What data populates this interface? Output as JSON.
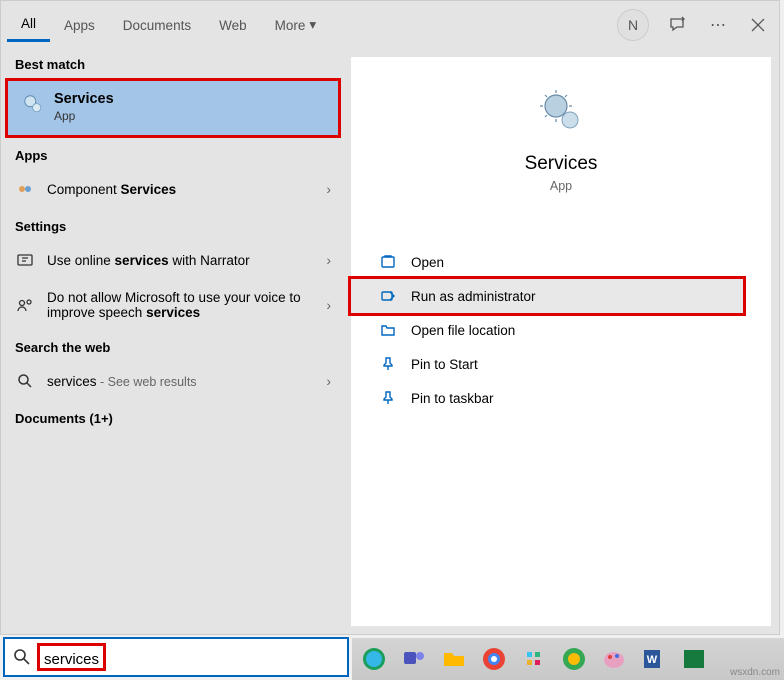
{
  "tabs": {
    "all": "All",
    "apps": "Apps",
    "documents": "Documents",
    "web": "Web",
    "more": "More"
  },
  "avatar_letter": "N",
  "labels": {
    "best_match": "Best match",
    "apps": "Apps",
    "settings": "Settings",
    "search_web": "Search the web",
    "documents": "Documents (1+)"
  },
  "best_match": {
    "title": "Services",
    "subtitle": "App"
  },
  "apps_item": {
    "prefix": "Component ",
    "bold": "Services"
  },
  "settings_items": {
    "s1_pre": "Use online ",
    "s1_b": "services",
    "s1_post": " with Narrator",
    "s2_pre": "Do not allow Microsoft to use your voice to improve speech ",
    "s2_b": "services"
  },
  "web_item": {
    "term": "services",
    "suffix": " - See web results"
  },
  "hero": {
    "title": "Services",
    "subtitle": "App"
  },
  "actions": {
    "open": "Open",
    "run_admin": "Run as administrator",
    "open_loc": "Open file location",
    "pin_start": "Pin to Start",
    "pin_taskbar": "Pin to taskbar"
  },
  "search": {
    "value": "services"
  },
  "watermark": "wsxdn.com"
}
